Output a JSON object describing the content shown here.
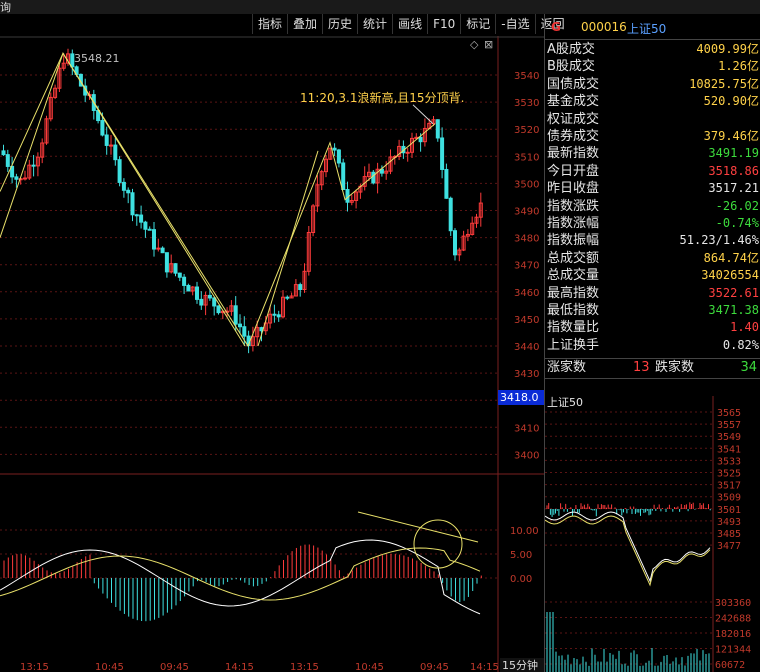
{
  "window_title": "询",
  "toolbar": [
    "指标",
    "叠加",
    "历史",
    "统计",
    "画线",
    "F10",
    "标记",
    "-自选",
    "返回"
  ],
  "toolbar_icons": {
    "diamond": "◇",
    "close": "⊠"
  },
  "main_chart": {
    "high_label": "3548.21",
    "annotation": "11:20,3.1浪新高,且15分顶背.",
    "price_axis": [
      "3540",
      "3530",
      "3520",
      "3510",
      "3500",
      "3490",
      "3480",
      "3470",
      "3460",
      "3450",
      "3440",
      "3430",
      "3420",
      "3410",
      "3400"
    ],
    "price_box": "3418.0",
    "macd_axis": [
      "10.00",
      "5.00",
      "0.00"
    ],
    "time_axis": [
      "13:15",
      "10:45",
      "09:45",
      "14:15",
      "13:15",
      "10:45",
      "09:45",
      "14:15"
    ],
    "period": "15分钟"
  },
  "quote": {
    "flag": "G",
    "code": "000016",
    "name": "上证50",
    "rows": [
      {
        "label": "A股成交",
        "value": "4009.99亿",
        "color": "#ffd24a"
      },
      {
        "label": "B股成交",
        "value": "1.26亿",
        "color": "#ffd24a"
      },
      {
        "label": "国债成交",
        "value": "10825.75亿",
        "color": "#ffd24a"
      },
      {
        "label": "基金成交",
        "value": "520.90亿",
        "color": "#ffd24a"
      },
      {
        "label": "权证成交",
        "value": "",
        "color": "#ffd24a"
      },
      {
        "label": "债券成交",
        "value": "379.46亿",
        "color": "#ffd24a"
      },
      {
        "label": "最新指数",
        "value": "3491.19",
        "color": "#3ddc3d"
      },
      {
        "label": "今日开盘",
        "value": "3518.86",
        "color": "#ff4040"
      },
      {
        "label": "昨日收盘",
        "value": "3517.21",
        "color": "#e6e6e6"
      },
      {
        "label": "指数涨跌",
        "value": "-26.02",
        "color": "#3ddc3d"
      },
      {
        "label": "指数涨幅",
        "value": "-0.74%",
        "color": "#3ddc3d"
      },
      {
        "label": "指数振幅",
        "value": "51.23/1.46%",
        "color": "#e6e6e6"
      },
      {
        "label": "总成交额",
        "value": "864.74亿",
        "color": "#ffd24a"
      },
      {
        "label": "总成交量",
        "value": "34026554",
        "color": "#ffd24a"
      },
      {
        "label": "最高指数",
        "value": "3522.61",
        "color": "#ff4040"
      },
      {
        "label": "最低指数",
        "value": "3471.38",
        "color": "#3ddc3d"
      },
      {
        "label": "指数量比",
        "value": "1.40",
        "color": "#ff4040"
      },
      {
        "label": "上证换手",
        "value": "0.82%",
        "color": "#e6e6e6"
      }
    ],
    "rising_label": "涨家数",
    "rising": "13",
    "falling_label": "跌家数",
    "falling": "34"
  },
  "mini_chart": {
    "title": "上证50",
    "price_axis": [
      "3565",
      "3557",
      "3549",
      "3541",
      "3533",
      "3525",
      "3517",
      "3509",
      "3501",
      "3493",
      "3485",
      "3477"
    ],
    "volume_axis": [
      "303360",
      "242688",
      "182016",
      "121344",
      "60672"
    ]
  }
}
